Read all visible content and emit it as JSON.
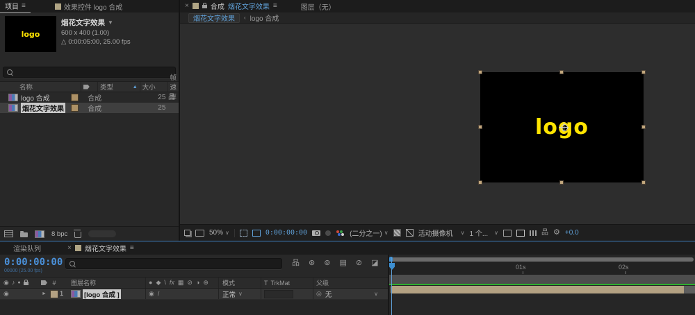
{
  "glyphs": {
    "menu": "≡",
    "close": "×",
    "chevron_down": "∨",
    "chevron_left": "‹",
    "sort_asc": "▲",
    "dropdown_arrow": "▼",
    "expand_arrow": "►",
    "duration_delta": "△",
    "flowchart": "品",
    "pickwhip": "◎",
    "eye": "◉",
    "audio": "♪",
    "solo": "●",
    "hash": "#",
    "quality": "/",
    "shy_row": "◉",
    "t_label": "T"
  },
  "project": {
    "tab_project": "项目",
    "tab_effects": "效果控件 logo 合成",
    "preview": {
      "comp_name": "烟花文字效果",
      "dimensions": "600 x 400 (1.00)",
      "duration": "0:00:05:00, 25.00 fps",
      "thumb_text": "logo"
    },
    "columns": {
      "name": "名称",
      "type": "类型",
      "size": "大小",
      "fps": "帧速率"
    },
    "rows": [
      {
        "name": "logo 合成",
        "type": "合成",
        "fps": "25"
      },
      {
        "name": "烟花文字效果",
        "type": "合成",
        "fps": "25"
      }
    ],
    "color_depth": "8 bpc"
  },
  "viewer": {
    "tab_panel": "合成",
    "tab_comp_name": "烟花文字效果",
    "tab_layer": "图层（无）",
    "breadcrumb": {
      "current": "烟花文字效果",
      "parent": "logo 合成"
    },
    "canvas_text": "logo",
    "toolbar": {
      "zoom": "50%",
      "timecode": "0:00:00:00",
      "resolution": "(二分之一)",
      "camera": "活动摄像机",
      "views": "1 个...",
      "exposure": "+0.0"
    }
  },
  "timeline": {
    "tab_render_queue": "渲染队列",
    "tab_comp": "烟花文字效果",
    "timecode": "0:00:00:00",
    "timecode_sub": "00000 (25.00 fps)",
    "columns": {
      "layer_name": "图层名称",
      "mode": "模式",
      "trkmat": "TrkMat",
      "parent": "父级"
    },
    "switch_icons": [
      "●",
      "◆",
      "\\",
      "fx",
      "▦",
      "⊘",
      "◑",
      "⊕"
    ],
    "tool_icons": [
      "品",
      "⊛",
      "⊚",
      "▤",
      "⊘",
      "◪"
    ],
    "layer": {
      "index": "1",
      "name": "[logo 合成 ]",
      "mode": "正常",
      "parent": "无"
    },
    "ruler_labels": [
      "01s",
      "02s"
    ]
  },
  "colors": {
    "accent_blue": "#5f9fd6",
    "label_tan": "#b3a182",
    "cache_green": "#2fae2f",
    "logo_yellow": "#ffe400"
  }
}
